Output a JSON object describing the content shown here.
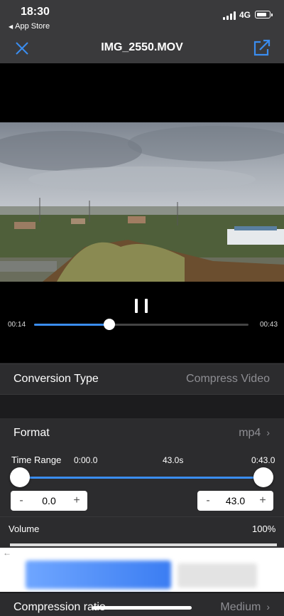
{
  "status_bar": {
    "time": "18:30",
    "back_app": "App Store",
    "network": "4G"
  },
  "nav": {
    "title": "IMG_2550.MOV",
    "close_icon": "close-icon",
    "share_icon": "share-icon",
    "accent_color": "#3a8df0"
  },
  "player": {
    "current_time": "00:14",
    "end_time": "00:43",
    "progress": 0.35,
    "state_icon": "pause-icon"
  },
  "settings": {
    "conversion_type": {
      "label": "Conversion Type",
      "value": "Compress Video"
    },
    "format": {
      "label": "Format",
      "value": "mp4"
    },
    "time_range": {
      "label": "Time Range",
      "start_display": "0:00.0",
      "duration_display": "43.0s",
      "end_display": "0:43.0",
      "start_value": "0.0",
      "end_value": "43.0",
      "minus": "-",
      "plus": "+"
    },
    "volume": {
      "label": "Volume",
      "value": "100%"
    },
    "compression_ratio": {
      "label": "Compression ratio",
      "value": "Medium"
    }
  }
}
